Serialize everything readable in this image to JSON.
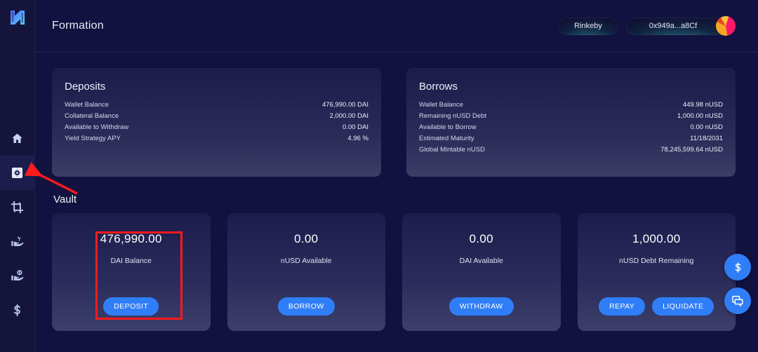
{
  "sidebar": {
    "logo": "nucleus-n-logo",
    "items": [
      {
        "name": "home",
        "icon": "home-icon",
        "active": false
      },
      {
        "name": "vault",
        "icon": "vault-safe-icon",
        "active": true
      },
      {
        "name": "transmute",
        "icon": "transmute-icon",
        "active": false
      },
      {
        "name": "farm",
        "icon": "hand-sprout-icon",
        "active": false
      },
      {
        "name": "lend",
        "icon": "hand-coin-icon",
        "active": false
      },
      {
        "name": "dollar",
        "icon": "dollar-icon",
        "active": false
      }
    ]
  },
  "header": {
    "title": "Formation",
    "network": "Rinkeby",
    "wallet": "0x949a...a8Cf",
    "avatar_name": "wallet-avatar"
  },
  "deposits": {
    "title": "Deposits",
    "rows": [
      {
        "label": "Wallet Balance",
        "value": "476,990.00 DAI"
      },
      {
        "label": "Collateral Balance",
        "value": "2,000.00 DAI"
      },
      {
        "label": "Available to Withdraw",
        "value": "0.00 DAI"
      },
      {
        "label": "Yield Strategy APY",
        "value": "4.96 %"
      }
    ]
  },
  "borrows": {
    "title": "Borrows",
    "rows": [
      {
        "label": "Wallet Balance",
        "value": "449.98 nUSD"
      },
      {
        "label": "Remaining nUSD Debt",
        "value": "1,000.00 nUSD"
      },
      {
        "label": "Available to Borrow",
        "value": "0.00 nUSD"
      },
      {
        "label": "Estimated Maturity",
        "value": "11/18/2031"
      },
      {
        "label": "Global Mintable nUSD",
        "value": "78,245,599.64 nUSD"
      }
    ]
  },
  "vault": {
    "section_title": "Vault",
    "cards": [
      {
        "amount": "476,990.00",
        "label": "DAI Balance",
        "actions": [
          "DEPOSIT"
        ]
      },
      {
        "amount": "0.00",
        "label": "nUSD Available",
        "actions": [
          "BORROW"
        ]
      },
      {
        "amount": "0.00",
        "label": "DAI Available",
        "actions": [
          "WITHDRAW"
        ]
      },
      {
        "amount": "1,000.00",
        "label": "nUSD Debt Remaining",
        "actions": [
          "REPAY",
          "LIQUIDATE"
        ]
      }
    ]
  },
  "fabs": [
    {
      "name": "price-fab",
      "icon": "dollar-icon"
    },
    {
      "name": "chat-fab",
      "icon": "chat-icon"
    }
  ],
  "annotations": {
    "highlight_box": {
      "target": "deposit-vault-card"
    },
    "arrow": {
      "target": "sidebar-item-vault"
    }
  },
  "colors": {
    "accent": "#2f7ef7",
    "background": "#121240",
    "sidebar": "#15153c",
    "card_top": "#1b1c4a",
    "card_bottom": "#3d3f6a",
    "annotation": "#ff1b1b"
  }
}
